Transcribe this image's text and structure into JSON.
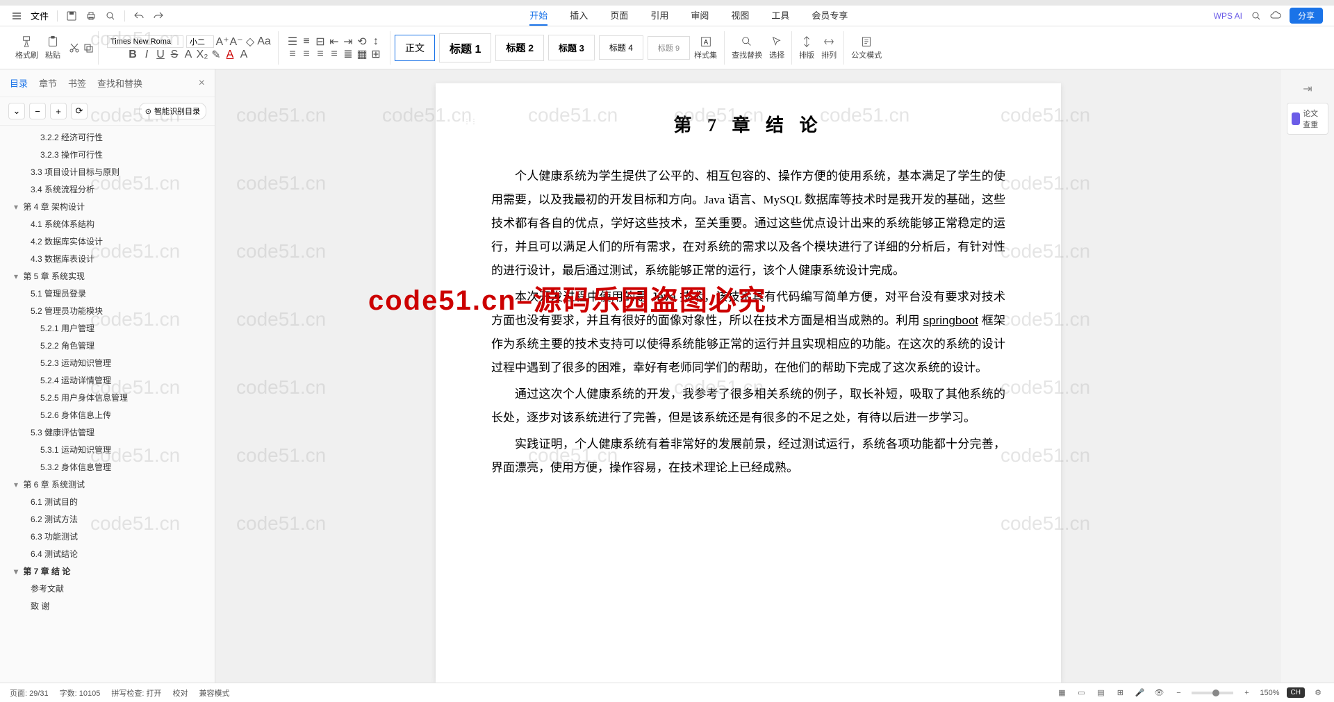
{
  "menubar": {
    "file_label": "文件",
    "tabs": [
      "开始",
      "插入",
      "页面",
      "引用",
      "审阅",
      "视图",
      "工具",
      "会员专享"
    ],
    "active_tab": "开始",
    "wps_ai": "WPS AI",
    "share": "分享"
  },
  "ribbon": {
    "format_painter": "格式刷",
    "paste": "粘贴",
    "font_name": "Times New Roma",
    "font_size": "小二",
    "styles": {
      "body": "正文",
      "h1": "标题 1",
      "h2": "标题 2",
      "h3": "标题 3",
      "h4": "标题 4",
      "h9": "标题 9"
    },
    "style_set": "样式集",
    "find_replace": "查找替换",
    "select": "选择",
    "arrange_v": "排版",
    "arrange_h": "排列",
    "gov_mode": "公文模式"
  },
  "sidebar": {
    "tabs": [
      "目录",
      "章节",
      "书签",
      "查找和替换"
    ],
    "active": "目录",
    "smart": "智能识别目录",
    "items": [
      {
        "level": 3,
        "text": "3.2.2 经济可行性"
      },
      {
        "level": 3,
        "text": "3.2.3 操作可行性"
      },
      {
        "level": 2,
        "text": "3.3  项目设计目标与原则"
      },
      {
        "level": 2,
        "text": "3.4  系统流程分析"
      },
      {
        "level": 1,
        "text": "第 4 章  架构设计"
      },
      {
        "level": 2,
        "text": "4.1  系统体系结构"
      },
      {
        "level": 2,
        "text": "4.2  数据库实体设计"
      },
      {
        "level": 2,
        "text": "4.3  数据库表设计"
      },
      {
        "level": 1,
        "text": "第 5 章  系统实现"
      },
      {
        "level": 2,
        "text": "5.1  管理员登录"
      },
      {
        "level": 2,
        "text": "5.2  管理员功能模块"
      },
      {
        "level": 3,
        "text": "5.2.1 用户管理"
      },
      {
        "level": 3,
        "text": "5.2.2 角色管理"
      },
      {
        "level": 3,
        "text": "5.2.3 运动知识管理"
      },
      {
        "level": 3,
        "text": "5.2.4 运动详情管理"
      },
      {
        "level": 3,
        "text": "5.2.5 用户身体信息管理"
      },
      {
        "level": 3,
        "text": "5.2.6 身体信息上传"
      },
      {
        "level": 2,
        "text": "5.3  健康评估管理"
      },
      {
        "level": 3,
        "text": "5.3.1 运动知识管理"
      },
      {
        "level": 3,
        "text": "5.3.2 身体信息管理"
      },
      {
        "level": 1,
        "text": "第 6 章  系统测试"
      },
      {
        "level": 2,
        "text": "6.1  测试目的"
      },
      {
        "level": 2,
        "text": "6.2  测试方法"
      },
      {
        "level": 2,
        "text": "6.3  功能测试"
      },
      {
        "level": 2,
        "text": "6.4  测试结论"
      },
      {
        "level": 1,
        "text": "第 7 章 结  论",
        "current": true
      },
      {
        "level": 2,
        "text": "参考文献"
      },
      {
        "level": 2,
        "text": "致  谢"
      }
    ]
  },
  "document": {
    "title": "第 7 章 结  论",
    "p1_part1": "个人健康系统为学生提供了公平的、相互包容的、操作方便的使用系统，基本满足了学生的使用需要，以及我最初的开发目标和方向。Java 语言、MySQL 数据库等技术时是我开发的基础，这些技术都有各自的优点，学好这些技术，至关重要。通过这些优点设计出来的系统能够正常稳定的运行，并且可以满足人们的所有需求，在对系统的需求以及各个模块进行了详细的分析后，有针对性的进行设计，最后通过测试，系统能够正常的运行，该个人健康系统设计完成。",
    "p2_pre": "本次开发过程中使用的是 Java 技术，该技术具有代码编写简单方便，对平台没有要求对技术方面也没有要求，并且有很好的面像对象性，所以在技术方面是相当成熟的。利用 ",
    "p2_link": "springboot",
    "p2_post": " 框架作为系统主要的技术支持可以使得系统能够正常的运行并且实现相应的功能。在这次的系统的设计过程中遇到了很多的困难，幸好有老师同学们的帮助，在他们的帮助下完成了这次系统的设计。",
    "p3": "通过这次个人健康系统的开发，我参考了很多相关系统的例子，取长补短，吸取了其他系统的长处，逐步对该系统进行了完善，但是该系统还是有很多的不足之处，有待以后进一步学习。",
    "p4": "实践证明，个人健康系统有着非常好的发展前景，经过测试运行，系统各项功能都十分完善，界面漂亮，使用方便，操作容易，在技术理论上已经成熟。"
  },
  "statusbar": {
    "page": "页面: 29/31",
    "words": "字数: 10105",
    "spell": "拼写检查: 打开",
    "proofread": "校对",
    "compat": "兼容模式",
    "zoom": "150%",
    "lang": "CH"
  },
  "rightbar": {
    "check": "论文查重"
  },
  "overlay": "code51.cn–源码乐园盗图必究",
  "watermark_text": "code51.cn"
}
